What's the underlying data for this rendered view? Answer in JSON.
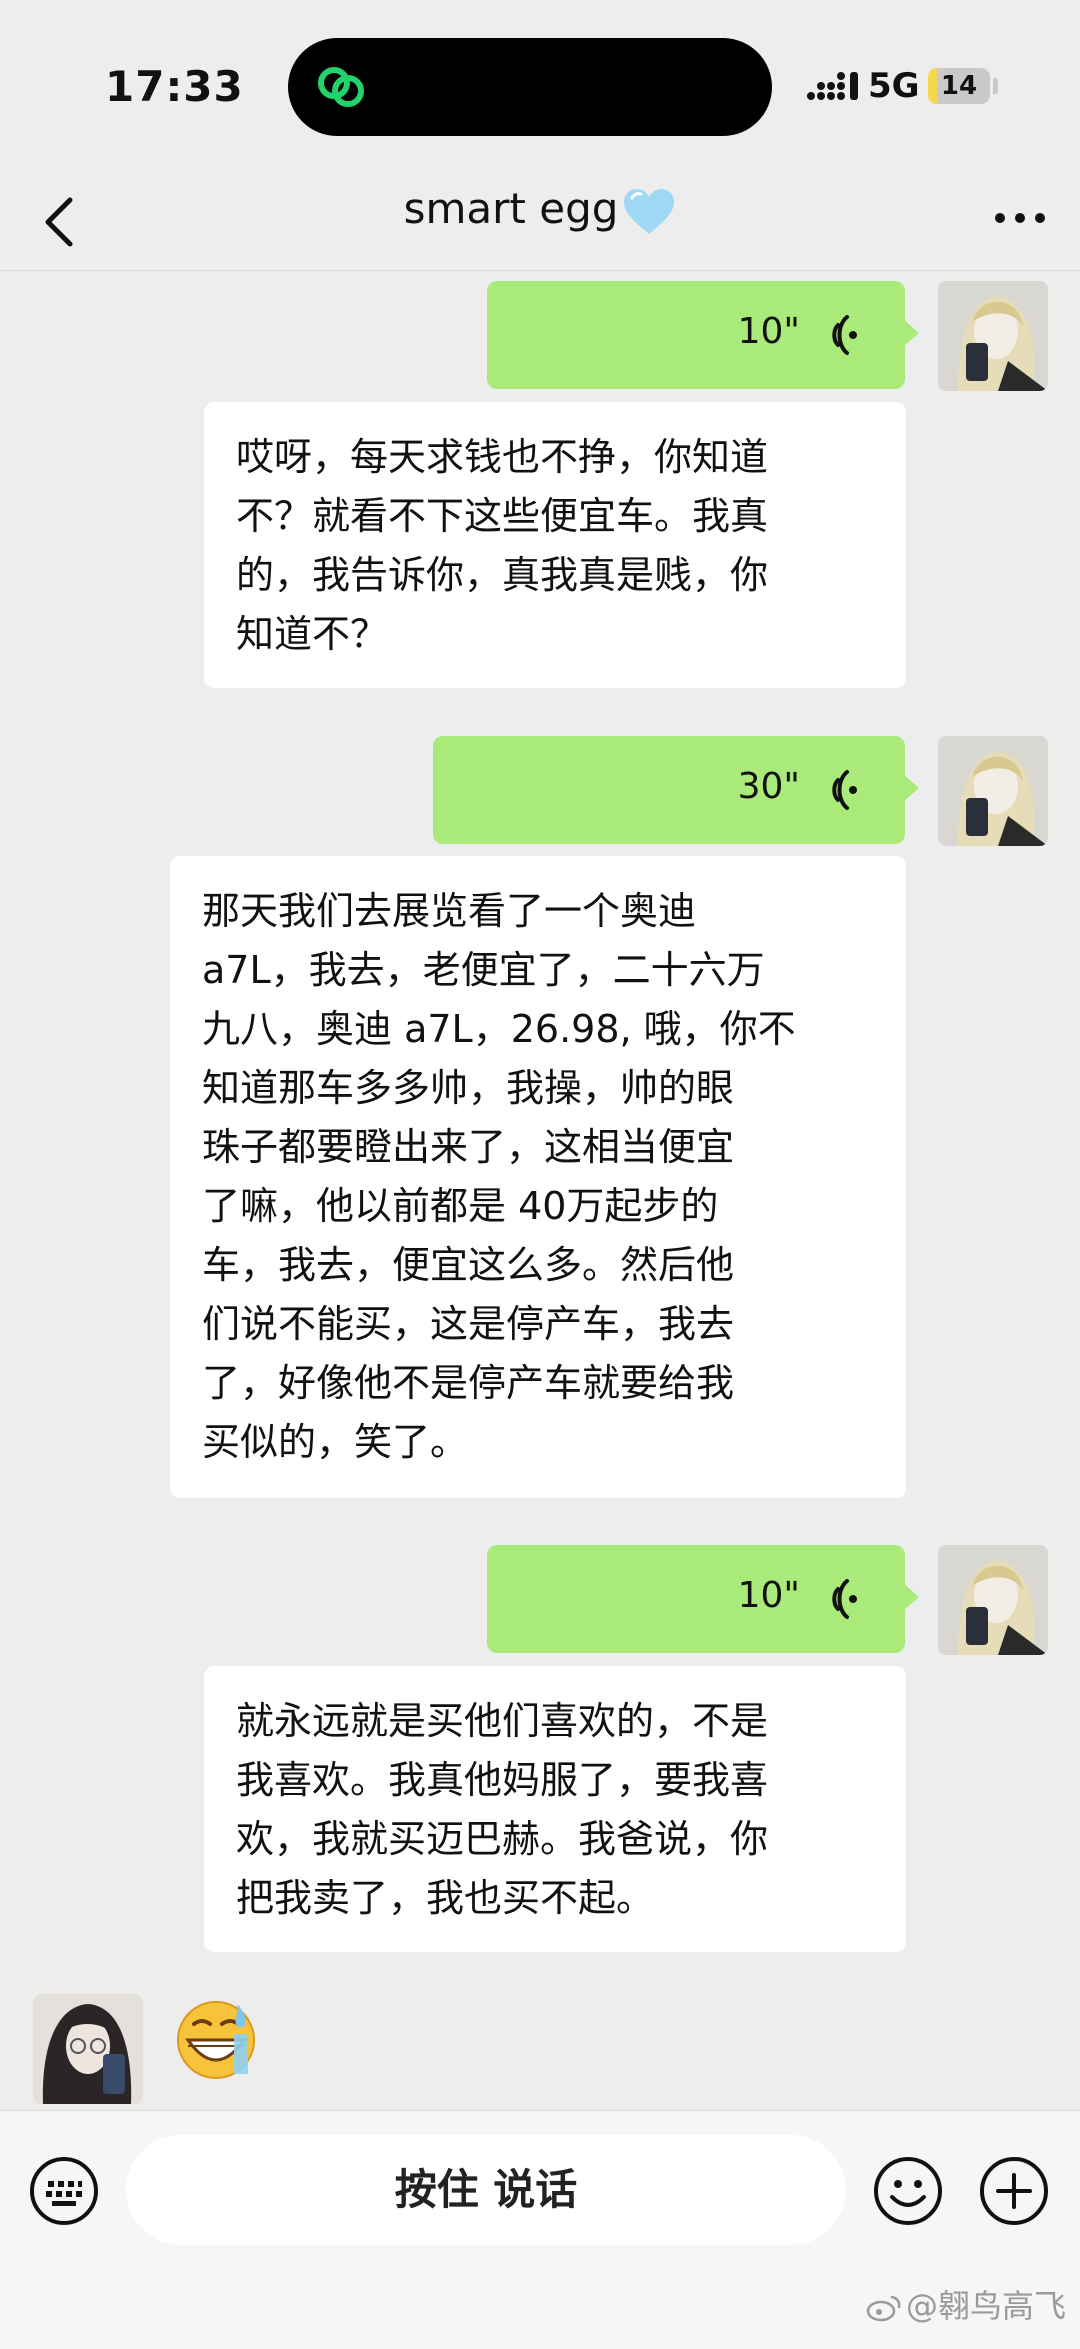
{
  "status_bar": {
    "time": "17:33",
    "network": "5G",
    "battery": "14",
    "battery_level_percent": 14
  },
  "header": {
    "title": "smart egg",
    "title_emoji": "light-blue-heart"
  },
  "messages": [
    {
      "side": "right",
      "type": "voice",
      "duration": "10\""
    },
    {
      "side": "left",
      "type": "text",
      "text": "哎呀，每天求钱也不挣，你知道\n不？就看不下这些便宜车。我真\n的，我告诉你，真我真是贱，你\n知道不？"
    },
    {
      "side": "right",
      "type": "voice",
      "duration": "30\""
    },
    {
      "side": "left",
      "type": "text",
      "text": "那天我们去展览看了一个奥迪\na7L，我去，老便宜了，二十六万\n九八，奥迪 a7L，26.98, 哦，你不\n知道那车多多帅，我操，帅的眼\n珠子都要瞪出来了，这相当便宜\n了嘛，他以前都是 40万起步的\n车，我去，便宜这么多。然后他\n们说不能买，这是停产车，我去\n了，好像他不是停产车就要给我\n买似的，笑了。"
    },
    {
      "side": "right",
      "type": "voice",
      "duration": "10\""
    },
    {
      "side": "left",
      "type": "text",
      "text": "就永远就是买他们喜欢的，不是\n我喜欢。我真他妈服了，要我喜\n欢，我就买迈巴赫。我爸说，你\n把我卖了，我也买不起。"
    },
    {
      "side": "left",
      "type": "emoji",
      "emoji": "grinning-sweat-face"
    }
  ],
  "input_bar": {
    "talk_label": "按住 说话"
  },
  "watermark": "@翱鸟高飞",
  "colors": {
    "voice_bubble": "#a9ea7a",
    "background": "#ededed",
    "text_bubble": "#ffffff"
  }
}
